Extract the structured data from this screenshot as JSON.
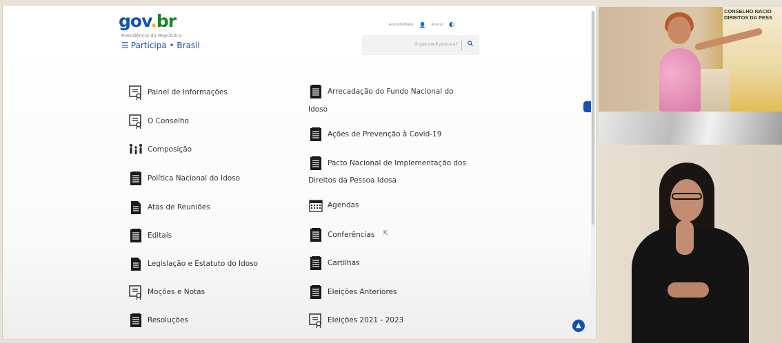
{
  "header": {
    "logo": {
      "gov": "gov",
      "dot": ".",
      "br": "br"
    },
    "org": "Presidência da República",
    "site_title": "Participa • Brasil",
    "links": {
      "accessibility": "Acessibilidade",
      "access": "Acesso"
    },
    "search_placeholder": "O que você procura?"
  },
  "left_menu": [
    {
      "label": "Painel de Informações",
      "icon": "certificate-icon"
    },
    {
      "label": "O Conselho",
      "icon": "certificate-icon"
    },
    {
      "label": "Composição",
      "icon": "people-icon"
    },
    {
      "label": "Política Nacional do Idoso",
      "icon": "notepad-icon"
    },
    {
      "label": "Atas de Reuniões",
      "icon": "document-icon"
    },
    {
      "label": "Editais",
      "icon": "notepad-icon"
    },
    {
      "label": "Legislação e Estatuto do Idoso",
      "icon": "document-icon"
    },
    {
      "label": "Moções e Notas",
      "icon": "certificate-icon"
    },
    {
      "label": "Resoluções",
      "icon": "notepad-icon"
    }
  ],
  "right_menu": [
    {
      "label": "Arrecadação do Fundo Nacional do",
      "label2": "Idoso",
      "icon": "notepad-icon"
    },
    {
      "label": "Ações de Prevenção à Covid-19",
      "icon": "notepad-icon"
    },
    {
      "label": "Pacto Nacional de Implementação dos",
      "label2": "Direitos da Pessoa Idosa",
      "icon": "notepad-icon"
    },
    {
      "label": "Agendas",
      "icon": "calendar-icon"
    },
    {
      "label": "Conferências",
      "icon": "notepad-icon"
    },
    {
      "label": "Cartilhas",
      "icon": "notepad-icon"
    },
    {
      "label": "Eleições Anteriores",
      "icon": "notepad-icon"
    },
    {
      "label": "Eleições 2021 - 2023",
      "icon": "certificate-icon"
    }
  ],
  "video": {
    "banner_text": "CONSELHO NACIO DIREITOS DA PESS"
  },
  "colors": {
    "brand_blue": "#1351b4",
    "brand_yellow": "#f6b200",
    "brand_green": "#168821"
  }
}
